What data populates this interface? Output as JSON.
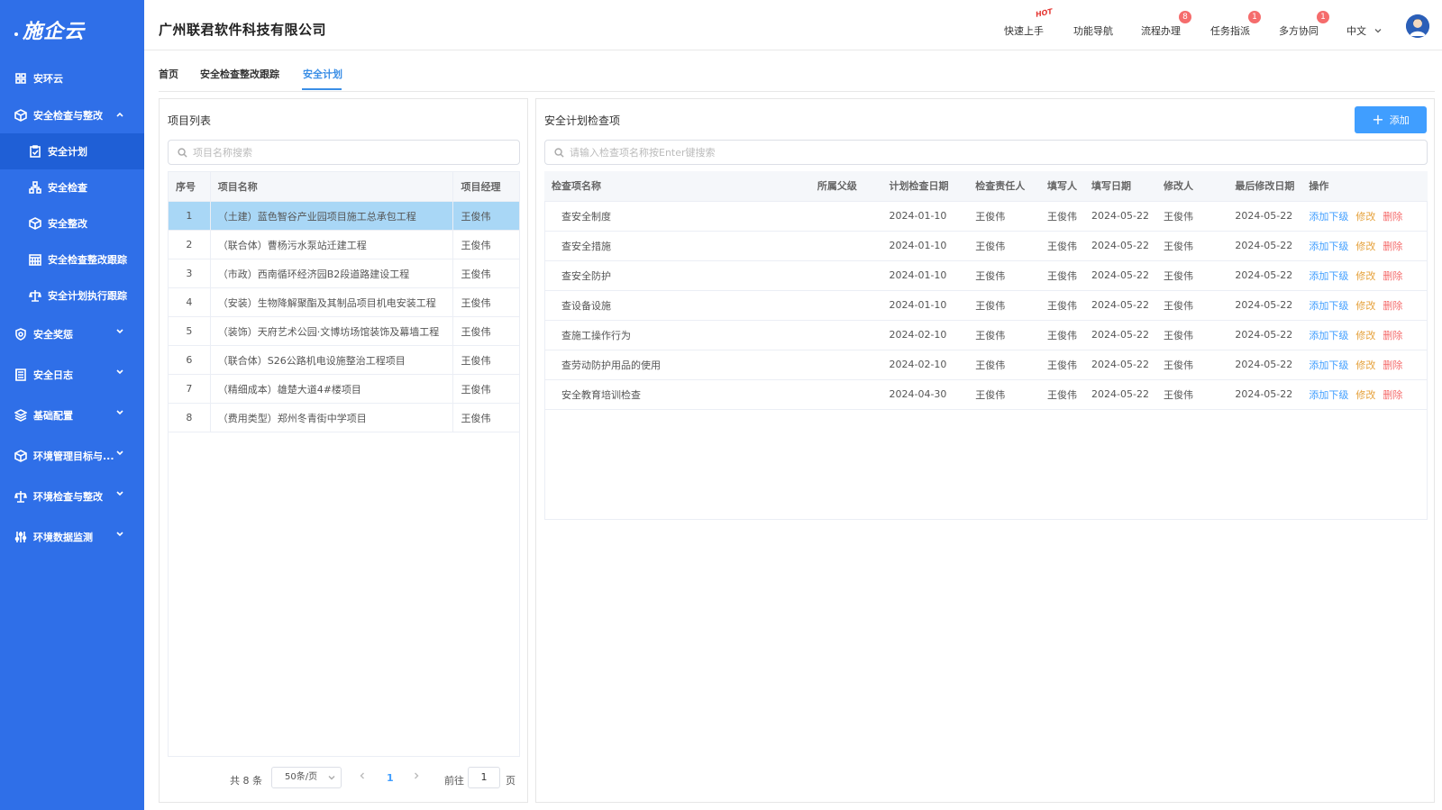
{
  "app": {
    "logo": "施企云",
    "company": "广州联君软件科技有限公司"
  },
  "sidebar": {
    "items": [
      {
        "label": "安环云",
        "icon": "grid-icon"
      },
      {
        "label": "安全检查与整改",
        "icon": "cube-icon"
      },
      {
        "label": "安全计划",
        "icon": "clipboard-check-icon"
      },
      {
        "label": "安全检查",
        "icon": "org-chart-icon"
      },
      {
        "label": "安全整改",
        "icon": "cube-icon"
      },
      {
        "label": "安全检查整改跟踪",
        "icon": "calendar-grid-icon"
      },
      {
        "label": "安全计划执行跟踪",
        "icon": "scale-icon"
      },
      {
        "label": "安全奖惩",
        "icon": "shield-icon"
      },
      {
        "label": "安全日志",
        "icon": "log-icon"
      },
      {
        "label": "基础配置",
        "icon": "layers-icon"
      },
      {
        "label": "环境管理目标与...",
        "icon": "cube-icon"
      },
      {
        "label": "环境检查与整改",
        "icon": "scale-icon"
      },
      {
        "label": "环境数据监测",
        "icon": "sliders-icon"
      }
    ]
  },
  "header": {
    "quick_start": "快速上手",
    "hot_badge": "HOT",
    "feature_nav": "功能导航",
    "process": "流程办理",
    "process_count": "8",
    "task": "任务指派",
    "task_count": "1",
    "collab": "多方协同",
    "collab_count": "1",
    "language": "中文"
  },
  "tabs": {
    "home": "首页",
    "tracking": "安全检查整改跟踪",
    "plan": "安全计划"
  },
  "left_panel": {
    "title": "项目列表",
    "search_placeholder": "项目名称搜索",
    "columns": {
      "no": "序号",
      "name": "项目名称",
      "manager": "项目经理"
    },
    "rows": [
      {
        "no": "1",
        "name": "（土建）蓝色智谷产业园项目施工总承包工程",
        "manager": "王俊伟"
      },
      {
        "no": "2",
        "name": "（联合体）曹杨污水泵站迁建工程",
        "manager": "王俊伟"
      },
      {
        "no": "3",
        "name": "（市政）西南循环经济园B2段道路建设工程",
        "manager": "王俊伟"
      },
      {
        "no": "4",
        "name": "（安装）生物降解聚酯及其制品项目机电安装工程",
        "manager": "王俊伟"
      },
      {
        "no": "5",
        "name": "（装饰）天府艺术公园·文博坊场馆装饰及幕墙工程",
        "manager": "王俊伟"
      },
      {
        "no": "6",
        "name": "（联合体）S26公路机电设施整治工程项目",
        "manager": "王俊伟"
      },
      {
        "no": "7",
        "name": "（精细成本）雄楚大道4#楼项目",
        "manager": "王俊伟"
      },
      {
        "no": "8",
        "name": "（费用类型）郑州冬青街中学项目",
        "manager": "王俊伟"
      }
    ],
    "pager": {
      "total": "共 8 条",
      "page_size": "50条/页",
      "current": "1",
      "goto_label": "前往",
      "goto_value": "1",
      "page_unit": "页"
    }
  },
  "right_panel": {
    "title": "安全计划检查项",
    "add_label": "添加",
    "search_placeholder": "请输入检查项名称按Enter键搜索",
    "columns": {
      "name": "检查项名称",
      "parent": "所属父级",
      "plan_date": "计划检查日期",
      "owner": "检查责任人",
      "writer": "填写人",
      "write_date": "填写日期",
      "modifier": "修改人",
      "last_modified": "最后修改日期",
      "ops": "操作"
    },
    "op_labels": {
      "add_child": "添加下级",
      "edit": "修改",
      "delete": "删除"
    },
    "rows": [
      {
        "name": "查安全制度",
        "parent": "",
        "plan_date": "2024-01-10",
        "owner": "王俊伟",
        "writer": "王俊伟",
        "write_date": "2024-05-22",
        "modifier": "王俊伟",
        "last_modified": "2024-05-22"
      },
      {
        "name": "查安全措施",
        "parent": "",
        "plan_date": "2024-01-10",
        "owner": "王俊伟",
        "writer": "王俊伟",
        "write_date": "2024-05-22",
        "modifier": "王俊伟",
        "last_modified": "2024-05-22"
      },
      {
        "name": "查安全防护",
        "parent": "",
        "plan_date": "2024-01-10",
        "owner": "王俊伟",
        "writer": "王俊伟",
        "write_date": "2024-05-22",
        "modifier": "王俊伟",
        "last_modified": "2024-05-22"
      },
      {
        "name": "查设备设施",
        "parent": "",
        "plan_date": "2024-01-10",
        "owner": "王俊伟",
        "writer": "王俊伟",
        "write_date": "2024-05-22",
        "modifier": "王俊伟",
        "last_modified": "2024-05-22"
      },
      {
        "name": "查施工操作行为",
        "parent": "",
        "plan_date": "2024-02-10",
        "owner": "王俊伟",
        "writer": "王俊伟",
        "write_date": "2024-05-22",
        "modifier": "王俊伟",
        "last_modified": "2024-05-22"
      },
      {
        "name": "查劳动防护用品的使用",
        "parent": "",
        "plan_date": "2024-02-10",
        "owner": "王俊伟",
        "writer": "王俊伟",
        "write_date": "2024-05-22",
        "modifier": "王俊伟",
        "last_modified": "2024-05-22"
      },
      {
        "name": "安全教育培训检查",
        "parent": "",
        "plan_date": "2024-04-30",
        "owner": "王俊伟",
        "writer": "王俊伟",
        "write_date": "2024-05-22",
        "modifier": "王俊伟",
        "last_modified": "2024-05-22"
      }
    ]
  },
  "colors": {
    "sidebar_bg": "#2f6fe8",
    "primary": "#409eff",
    "warning": "#e6a23c",
    "danger": "#f56c6c",
    "selected_row": "#a9d7f6"
  }
}
